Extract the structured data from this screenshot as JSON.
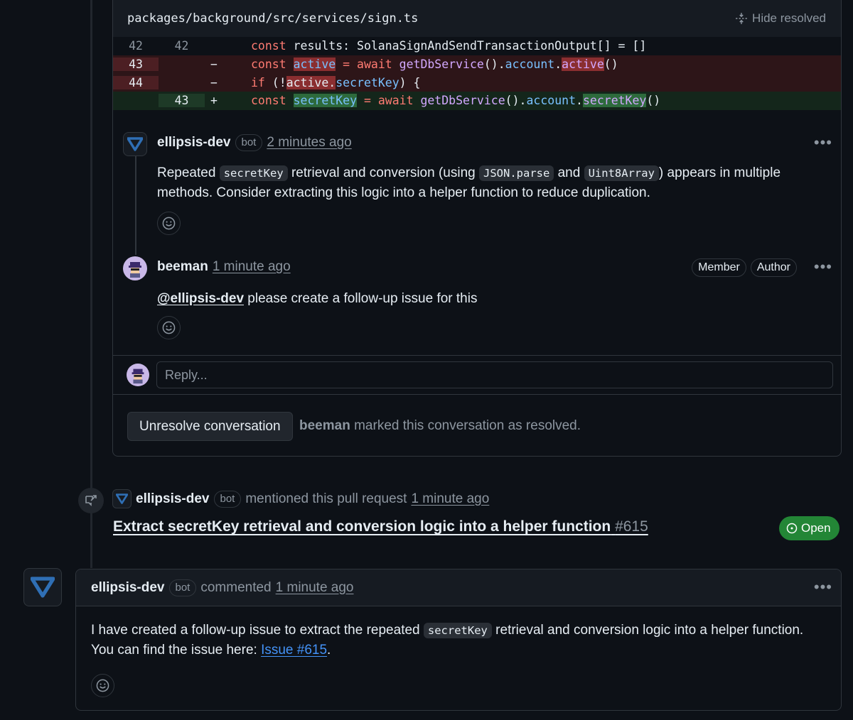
{
  "thread": {
    "file_path": "packages/background/src/services/sign.ts",
    "hide_resolved_label": "Hide resolved",
    "diff": [
      {
        "old": "42",
        "new": "42",
        "sign": "",
        "kind": "ctx"
      },
      {
        "old": "43",
        "new": "",
        "sign": "−",
        "kind": "del"
      },
      {
        "old": "44",
        "new": "",
        "sign": "−",
        "kind": "del"
      },
      {
        "old": "",
        "new": "43",
        "sign": "+",
        "kind": "add"
      }
    ],
    "code": {
      "l1": {
        "kw": "const",
        "rest": " results: SolanaSignAndSendTransactionOutput[] = []"
      },
      "l2": {
        "kw": "const",
        "var": "active",
        "eq": " = ",
        "await": "await",
        "fn": "getDbService",
        "p1": "().",
        "prop1": "account",
        "dot": ".",
        "prop2": "active",
        "end": "()"
      },
      "l3": {
        "kw": "if",
        "p1": " (!",
        "var": "active.",
        "prop": "secretKey",
        "end": ") {"
      },
      "l4": {
        "kw": "const",
        "var": "secretKey",
        "eq": " = ",
        "await": "await",
        "fn": "getDbService",
        "p1": "().",
        "prop1": "account",
        "dot": ".",
        "prop2": "secretKey",
        "end": "()"
      }
    },
    "comments": [
      {
        "author": "ellipsis-dev",
        "bot_label": "bot",
        "time": "2 minutes ago",
        "text_1": "Repeated ",
        "code_1": "secretKey",
        "text_2": " retrieval and conversion (using ",
        "code_2": "JSON.parse",
        "text_3": " and ",
        "code_3": "Uint8Array",
        "text_4": ") appears in multiple methods. Consider extracting this logic into a helper function to reduce duplication."
      },
      {
        "author": "beeman",
        "time": "1 minute ago",
        "member_label": "Member",
        "author_label": "Author",
        "mention": "@ellipsis-dev",
        "text": " please create a follow-up issue for this"
      }
    ],
    "reply_placeholder": "Reply...",
    "unresolve_label": "Unresolve conversation",
    "resolved_user": "beeman",
    "resolved_text": " marked this conversation as resolved."
  },
  "mention_event": {
    "author": "ellipsis-dev",
    "bot_label": "bot",
    "action": "mentioned this pull request",
    "time": "1 minute ago",
    "pr_title": "Extract secretKey retrieval and conversion logic into a helper function",
    "pr_number": "#615",
    "status": "Open"
  },
  "final_comment": {
    "author": "ellipsis-dev",
    "bot_label": "bot",
    "action": "commented",
    "time": "1 minute ago",
    "text_1": "I have created a follow-up issue to extract the repeated ",
    "code": "secretKey",
    "text_2": " retrieval and conversion logic into a helper function. You can find the issue here: ",
    "link": "Issue #615",
    "text_3": "."
  },
  "colors": {
    "background": "#0d1117",
    "deleted_row": "#2d1518",
    "added_row": "#14261b",
    "open_badge": "#238636",
    "link": "#4493f8"
  }
}
